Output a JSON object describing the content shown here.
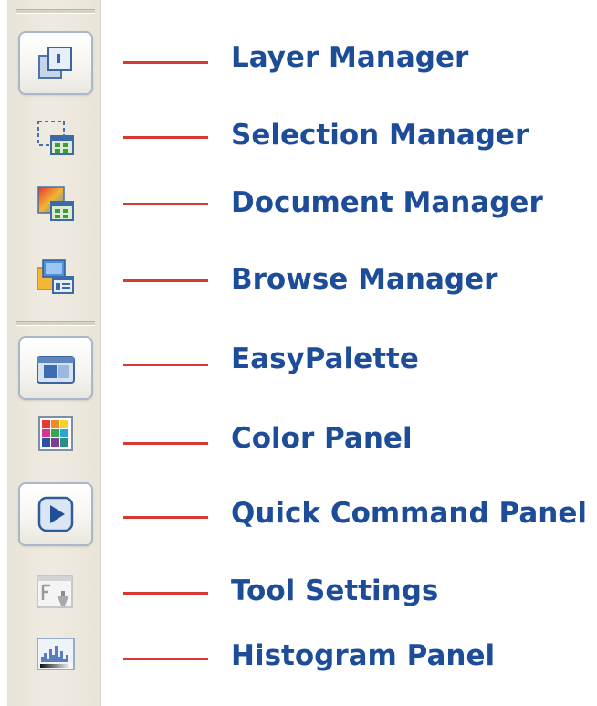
{
  "toolbar": {
    "items": [
      {
        "label": "Layer Manager",
        "icon": "layer-manager-icon",
        "active": true
      },
      {
        "label": "Selection Manager",
        "icon": "selection-manager-icon",
        "active": false
      },
      {
        "label": "Document Manager",
        "icon": "document-manager-icon",
        "active": false
      },
      {
        "label": "Browse Manager",
        "icon": "browse-manager-icon",
        "active": false
      },
      {
        "label": "EasyPalette",
        "icon": "easypalette-icon",
        "active": true
      },
      {
        "label": "Color Panel",
        "icon": "color-panel-icon",
        "active": false
      },
      {
        "label": "Quick Command Panel",
        "icon": "quick-command-panel-icon",
        "active": true
      },
      {
        "label": "Tool Settings",
        "icon": "tool-settings-icon",
        "active": false
      },
      {
        "label": "Histogram Panel",
        "icon": "histogram-panel-icon",
        "active": false
      }
    ]
  },
  "colors": {
    "label_text": "#1d4d99",
    "leader_line": "#d63a33",
    "toolbar_background": "#ece8de",
    "active_button_border": "#a9b7c9"
  }
}
